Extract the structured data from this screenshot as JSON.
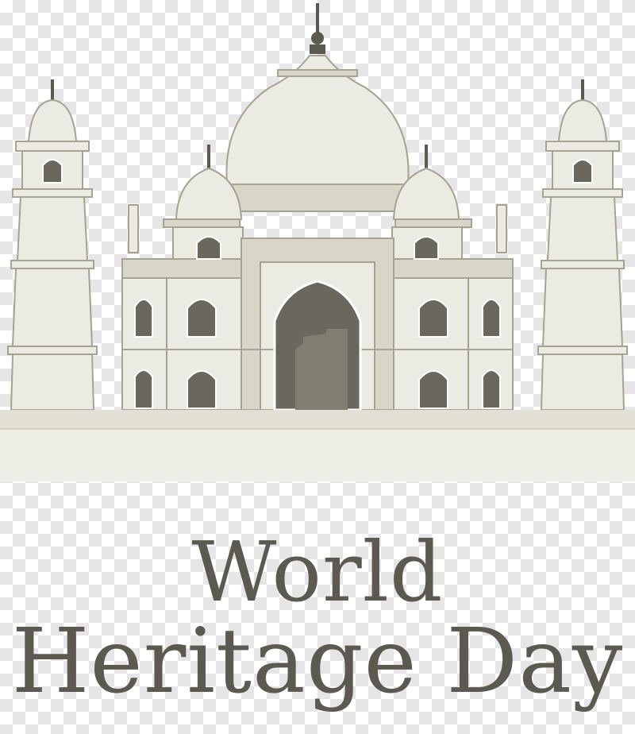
{
  "title": {
    "line1": "World",
    "line2": "Heritage Day"
  },
  "colors": {
    "marble": "#ecebe3",
    "marble_shadow": "#d8d6c8",
    "trim": "#c9c6b4",
    "outline": "#a7a391",
    "dark": "#5b5950",
    "window": "#6a675d",
    "arch_inner": "#817d70",
    "background_check": "#e6e6e6"
  }
}
